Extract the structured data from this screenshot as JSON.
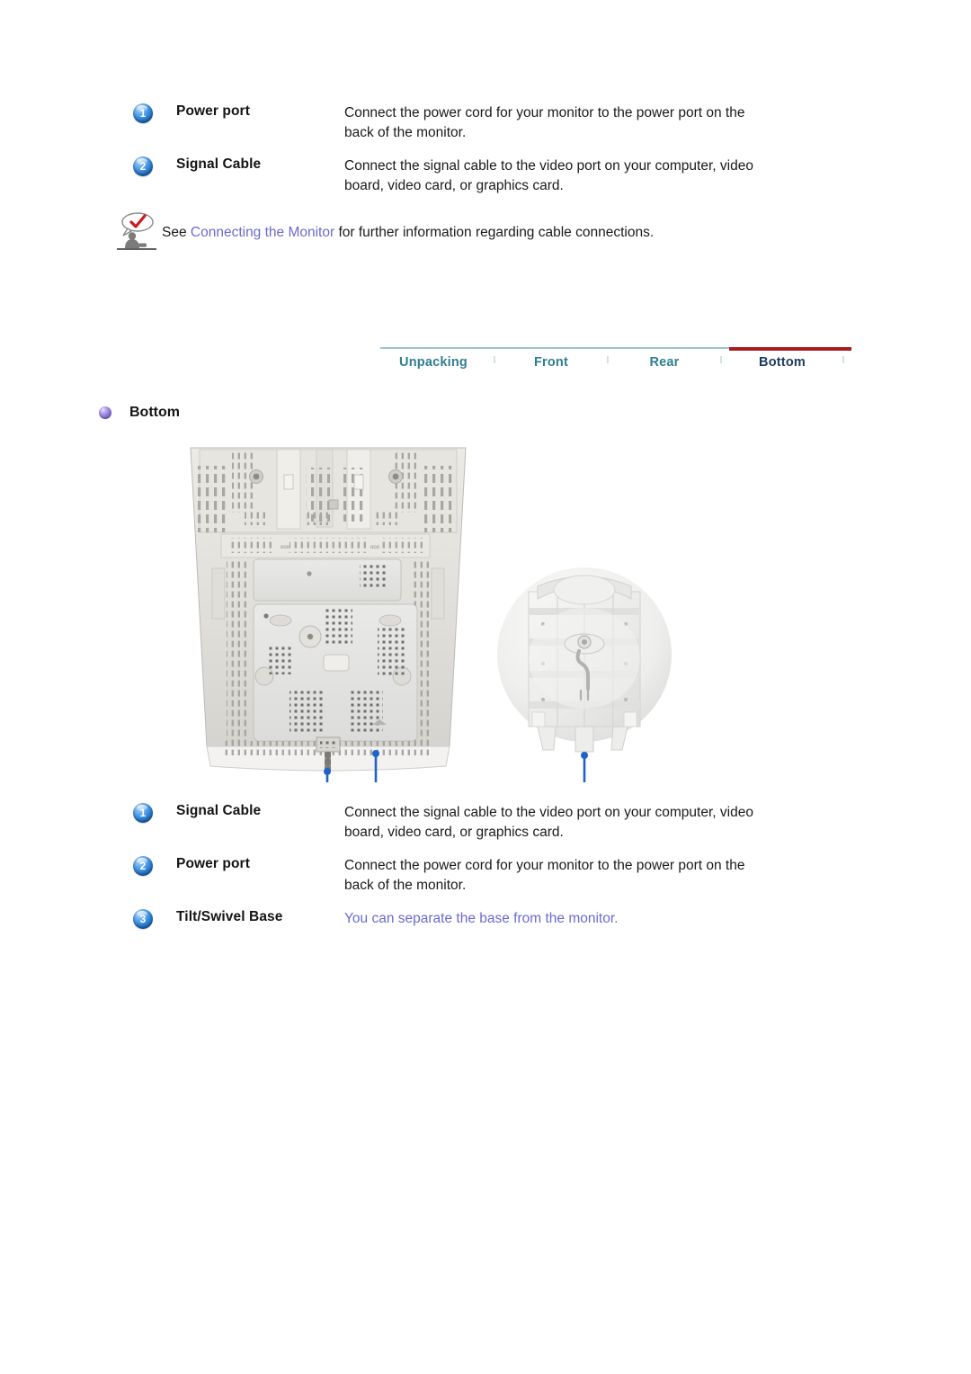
{
  "top_spec_list": {
    "rows": [
      {
        "number": "1",
        "term": "Power port",
        "description": "Connect the power cord for your monitor to the power port on the back of the monitor.",
        "style": "normal"
      },
      {
        "number": "2",
        "term": "Signal Cable",
        "description": "Connect the signal cable to the video port on your computer, video board, video card, or graphics card.",
        "style": "normal"
      }
    ]
  },
  "note": {
    "icon": "note-person-checkmark-icon",
    "prefix": "See ",
    "link_text": "Connecting the Monitor",
    "suffix": " for further information regarding cable connections."
  },
  "tabbar": {
    "separator": "l",
    "tabs": [
      {
        "label": "Unpacking",
        "active": false
      },
      {
        "label": "Front",
        "active": false
      },
      {
        "label": "Rear",
        "active": false
      },
      {
        "label": "Bottom",
        "active": true
      }
    ]
  },
  "section": {
    "bullet": "purple-orb-bullet",
    "title": "Bottom"
  },
  "figure": {
    "alt": "Bottom view of monitor with tilt/swivel base close-up",
    "callouts": [
      {
        "number": "1",
        "target": "signal-cable-port"
      },
      {
        "number": "2",
        "target": "power-port"
      },
      {
        "number": "3",
        "target": "tilt-swivel-base"
      }
    ]
  },
  "bottom_spec_list": {
    "rows": [
      {
        "number": "1",
        "term": "Signal Cable",
        "description": "Connect the signal cable to the video port on your computer, video board, video card, or graphics card.",
        "style": "normal"
      },
      {
        "number": "2",
        "term": "Power port",
        "description": "Connect the power cord for your monitor to the power port on the back of the monitor.",
        "style": "normal"
      },
      {
        "number": "3",
        "term": "Tilt/Swivel Base",
        "description": "You can separate the base from the monitor.",
        "style": "link"
      }
    ]
  },
  "colors": {
    "badge_blue": "#2b7fd4",
    "link_violet": "#6a6ad0",
    "tab_inactive": "#2f7e91",
    "tab_active": "#1b3a5c",
    "tab_active_rule": "#a81d20",
    "tab_rule": "#9fc3cf",
    "bullet_purple": "#8b77d8",
    "callout_blue": "#1f63c8"
  }
}
